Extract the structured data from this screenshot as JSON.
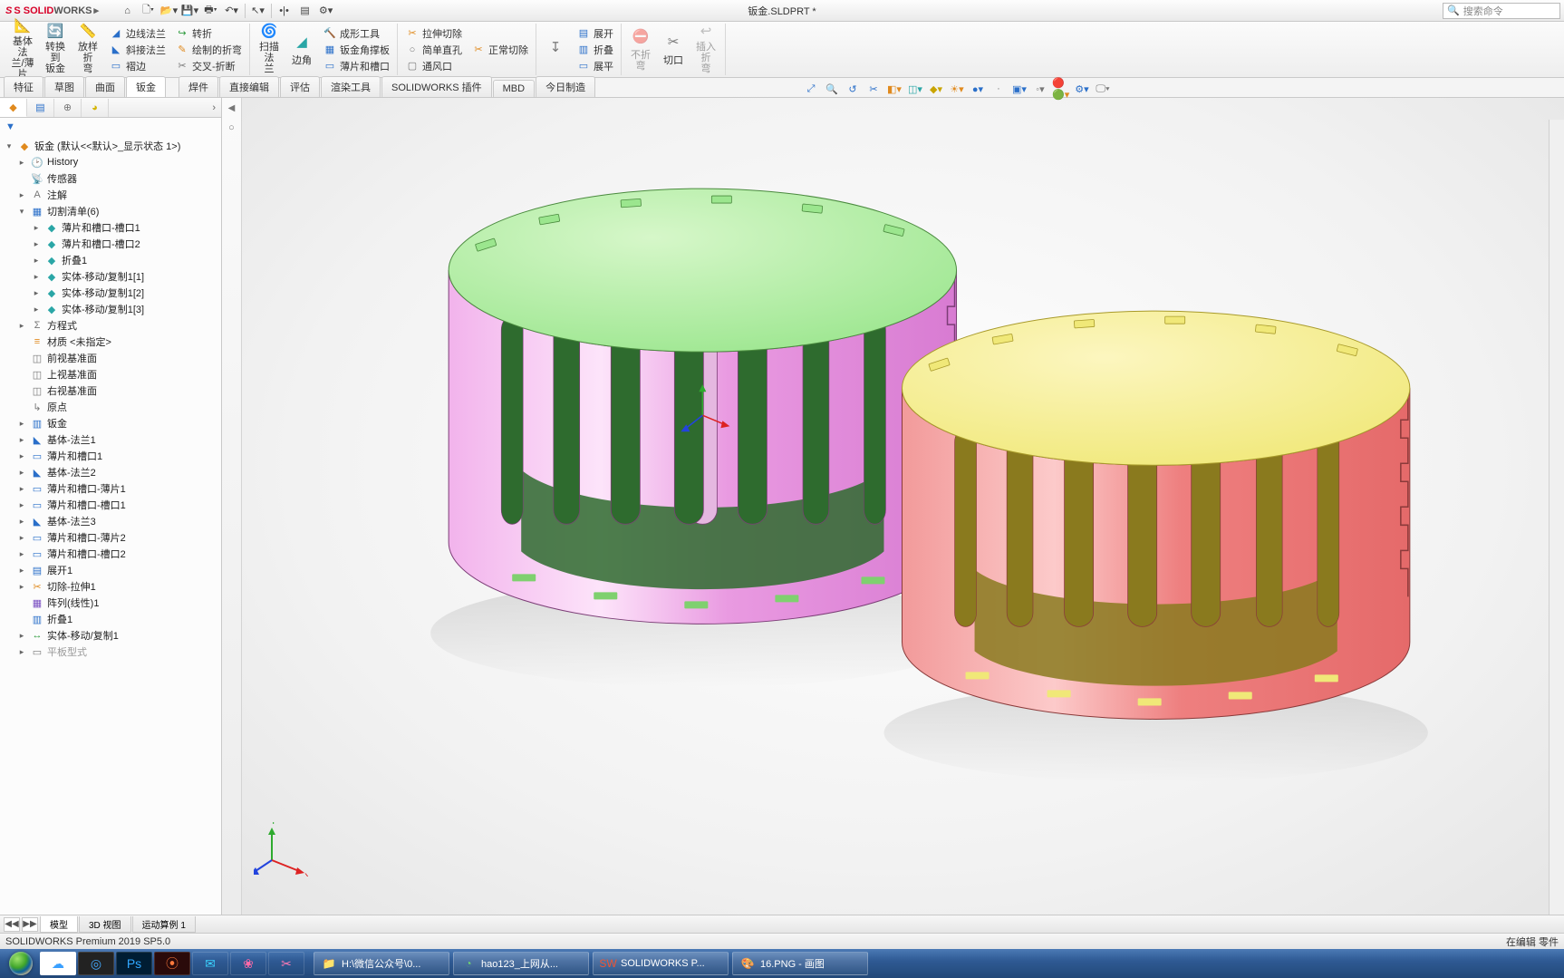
{
  "title_doc": "钣金.SLDPRT *",
  "search_placeholder": "搜索命令",
  "qat": [
    "home",
    "new",
    "open",
    "save",
    "print",
    "undo",
    "select",
    "rebuild",
    "options",
    "settings"
  ],
  "ribbon": {
    "groups": [
      {
        "large": [
          {
            "icon": "📐",
            "label": "基体法\n兰/薄片",
            "color": "c-blue"
          },
          {
            "icon": "🔄",
            "label": "转换到\n钣金",
            "color": "c-blue"
          },
          {
            "icon": "📏",
            "label": "放样折\n弯",
            "color": "c-blue"
          }
        ],
        "cols": [
          [
            {
              "icon": "◢",
              "label": "边线法兰",
              "color": "c-blue"
            },
            {
              "icon": "◣",
              "label": "斜接法兰",
              "color": "c-blue"
            },
            {
              "icon": "▭",
              "label": "褶边",
              "color": "c-blue"
            }
          ],
          [
            {
              "icon": "↪",
              "label": "转折",
              "color": "c-green"
            },
            {
              "icon": "✎",
              "label": "绘制的折弯",
              "color": "c-orange"
            },
            {
              "icon": "✂",
              "label": "交叉-折断",
              "color": "c-gray"
            }
          ]
        ]
      },
      {
        "large": [
          {
            "icon": "🌀",
            "label": "扫描法\n兰",
            "color": "c-blue"
          },
          {
            "icon": "◢",
            "label": "边角",
            "color": "c-teal"
          }
        ],
        "cols": [
          [
            {
              "icon": "🔨",
              "label": "成形工具",
              "color": "c-orange"
            },
            {
              "icon": "▦",
              "label": "钣金角撑板",
              "color": "c-blue"
            },
            {
              "icon": "▭",
              "label": "薄片和槽口",
              "color": "c-blue"
            }
          ]
        ]
      },
      {
        "cols": [
          [
            {
              "icon": "✂",
              "label": "拉伸切除",
              "color": "c-orange"
            },
            {
              "icon": "○",
              "label": "简单直孔",
              "color": "c-gray"
            },
            {
              "icon": "▢",
              "label": "通风口",
              "color": "c-gray"
            }
          ],
          [
            {
              "icon": "✂",
              "label": "正常切除",
              "color": "c-orange"
            }
          ]
        ]
      },
      {
        "large": [
          {
            "icon": "↧",
            "label": "",
            "color": "c-gray"
          }
        ],
        "cols": [
          [
            {
              "icon": "▤",
              "label": "展开",
              "color": "c-blue"
            },
            {
              "icon": "▥",
              "label": "折叠",
              "color": "c-blue"
            },
            {
              "icon": "▭",
              "label": "展平",
              "color": "c-blue"
            }
          ]
        ]
      },
      {
        "large": [
          {
            "icon": "⛔",
            "label": "不折弯",
            "color": "c-gray",
            "disabled": true
          },
          {
            "icon": "✂",
            "label": "切口",
            "color": "c-gray"
          },
          {
            "icon": "↩",
            "label": "插入折\n弯",
            "color": "c-gray",
            "disabled": true
          }
        ]
      }
    ]
  },
  "ribbon_tabs": [
    "特征",
    "草图",
    "曲面",
    "钣金",
    "焊件",
    "直接编辑",
    "评估",
    "渲染工具",
    "SOLIDWORKS 插件",
    "MBD",
    "今日制造"
  ],
  "ribbon_tab_active": 3,
  "ribbon_tab_gap_after": 3,
  "tree_root": "钣金  (默认<<默认>_显示状态 1>)",
  "tree": [
    {
      "d": 2,
      "tw": "▸",
      "ic": "🕑",
      "txt": "History",
      "color": "c-gray"
    },
    {
      "d": 2,
      "tw": "",
      "ic": "📡",
      "txt": "传感器",
      "color": "c-blue"
    },
    {
      "d": 2,
      "tw": "▸",
      "ic": "A",
      "txt": "注解",
      "color": "c-gray"
    },
    {
      "d": 2,
      "tw": "▾",
      "ic": "▦",
      "txt": "切割清单(6)",
      "color": "c-blue"
    },
    {
      "d": 3,
      "tw": "▸",
      "ic": "◆",
      "txt": "薄片和槽口-槽口1",
      "color": "c-teal"
    },
    {
      "d": 3,
      "tw": "▸",
      "ic": "◆",
      "txt": "薄片和槽口-槽口2",
      "color": "c-teal"
    },
    {
      "d": 3,
      "tw": "▸",
      "ic": "◆",
      "txt": "折叠1",
      "color": "c-teal"
    },
    {
      "d": 3,
      "tw": "▸",
      "ic": "◆",
      "txt": "实体-移动/复制1[1]",
      "color": "c-teal"
    },
    {
      "d": 3,
      "tw": "▸",
      "ic": "◆",
      "txt": "实体-移动/复制1[2]",
      "color": "c-teal"
    },
    {
      "d": 3,
      "tw": "▸",
      "ic": "◆",
      "txt": "实体-移动/复制1[3]",
      "color": "c-teal"
    },
    {
      "d": 2,
      "tw": "▸",
      "ic": "Σ",
      "txt": "方程式",
      "color": "c-gray"
    },
    {
      "d": 2,
      "tw": "",
      "ic": "≡",
      "txt": "材质 <未指定>",
      "color": "c-orange"
    },
    {
      "d": 2,
      "tw": "",
      "ic": "◫",
      "txt": "前视基准面",
      "color": "c-gray"
    },
    {
      "d": 2,
      "tw": "",
      "ic": "◫",
      "txt": "上视基准面",
      "color": "c-gray"
    },
    {
      "d": 2,
      "tw": "",
      "ic": "◫",
      "txt": "右视基准面",
      "color": "c-gray"
    },
    {
      "d": 2,
      "tw": "",
      "ic": "↳",
      "txt": "原点",
      "color": "c-gray"
    },
    {
      "d": 2,
      "tw": "▸",
      "ic": "▥",
      "txt": "钣金",
      "color": "c-blue"
    },
    {
      "d": 2,
      "tw": "▸",
      "ic": "◣",
      "txt": "基体-法兰1",
      "color": "c-blue"
    },
    {
      "d": 2,
      "tw": "▸",
      "ic": "▭",
      "txt": "薄片和槽口1",
      "color": "c-blue"
    },
    {
      "d": 2,
      "tw": "▸",
      "ic": "◣",
      "txt": "基体-法兰2",
      "color": "c-blue"
    },
    {
      "d": 2,
      "tw": "▸",
      "ic": "▭",
      "txt": "薄片和槽口-薄片1",
      "color": "c-blue"
    },
    {
      "d": 2,
      "tw": "▸",
      "ic": "▭",
      "txt": "薄片和槽口-槽口1",
      "color": "c-blue"
    },
    {
      "d": 2,
      "tw": "▸",
      "ic": "◣",
      "txt": "基体-法兰3",
      "color": "c-blue"
    },
    {
      "d": 2,
      "tw": "▸",
      "ic": "▭",
      "txt": "薄片和槽口-薄片2",
      "color": "c-blue"
    },
    {
      "d": 2,
      "tw": "▸",
      "ic": "▭",
      "txt": "薄片和槽口-槽口2",
      "color": "c-blue"
    },
    {
      "d": 2,
      "tw": "▸",
      "ic": "▤",
      "txt": "展开1",
      "color": "c-blue"
    },
    {
      "d": 2,
      "tw": "▸",
      "ic": "✂",
      "txt": "切除-拉伸1",
      "color": "c-orange"
    },
    {
      "d": 2,
      "tw": "",
      "ic": "▦",
      "txt": "阵列(线性)1",
      "color": "c-purple"
    },
    {
      "d": 2,
      "tw": "",
      "ic": "▥",
      "txt": "折叠1",
      "color": "c-blue"
    },
    {
      "d": 2,
      "tw": "▸",
      "ic": "↔",
      "txt": "实体-移动/复制1",
      "color": "c-green"
    },
    {
      "d": 2,
      "tw": "▸",
      "ic": "▭",
      "txt": "平板型式",
      "color": "c-gray",
      "faded": true
    }
  ],
  "view_tabs": [
    "模型",
    "3D 视图",
    "运动算例 1"
  ],
  "view_tab_active": 0,
  "status_left": "SOLIDWORKS Premium 2019 SP5.0",
  "status_right": "在编辑 零件",
  "taskbar": {
    "pins": [
      {
        "icon": "☁",
        "bg": "#fff",
        "fg": "#3aa0ff"
      },
      {
        "icon": "◎",
        "bg": "#222",
        "fg": "#4af"
      },
      {
        "icon": "Ps",
        "bg": "#001d33",
        "fg": "#31a8ff"
      },
      {
        "icon": "⦿",
        "bg": "#2a0a0a",
        "fg": "#ff7a3c"
      },
      {
        "icon": "✉",
        "bg": "transparent",
        "fg": "#3ad2ff"
      },
      {
        "icon": "❀",
        "bg": "transparent",
        "fg": "#ff6aa8"
      },
      {
        "icon": "✂",
        "bg": "transparent",
        "fg": "#ff7ab5"
      }
    ],
    "tasks": [
      {
        "icon": "📁",
        "label": "H:\\微信公众号\\0...",
        "fg": "#ffe08a"
      },
      {
        "icon": "◔",
        "label": "hao123_上网从...",
        "fg": "#6fd66f"
      },
      {
        "icon": "SW",
        "label": "SOLIDWORKS P...",
        "fg": "#e53"
      },
      {
        "icon": "🎨",
        "label": "16.PNG - 画图",
        "fg": "#a6d4ff"
      }
    ]
  }
}
